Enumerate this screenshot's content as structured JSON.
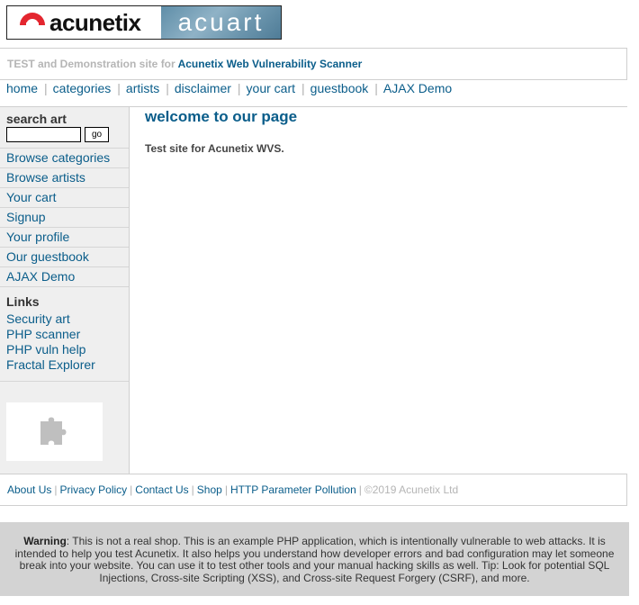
{
  "logo": {
    "brand_left": "acunetix",
    "brand_right": "acuart"
  },
  "tagline": {
    "prefix": "TEST and Demonstration site for",
    "product": "Acunetix Web Vulnerability Scanner"
  },
  "top_nav": {
    "items": [
      "home",
      "categories",
      "artists",
      "disclaimer",
      "your cart",
      "guestbook",
      "AJAX Demo"
    ]
  },
  "sidebar": {
    "search_title": "search art",
    "search_value": "",
    "go_label": "go",
    "menu": [
      "Browse categories",
      "Browse artists",
      "Your cart",
      "Signup",
      "Your profile",
      "Our guestbook",
      "AJAX Demo"
    ],
    "links_title": "Links",
    "links": [
      "Security art",
      "PHP scanner",
      "PHP vuln help",
      "Fractal Explorer"
    ]
  },
  "main": {
    "title": "welcome to our page",
    "intro": "Test site for Acunetix WVS."
  },
  "footer": {
    "links": [
      "About Us",
      "Privacy Policy",
      "Contact Us",
      "Shop",
      "HTTP Parameter Pollution"
    ],
    "copyright": "©2019 Acunetix Ltd"
  },
  "warning": {
    "label": "Warning",
    "text": ": This is not a real shop. This is an example PHP application, which is intentionally vulnerable to web attacks. It is intended to help you test Acunetix. It also helps you understand how developer errors and bad configuration may let someone break into your website. You can use it to test other tools and your manual hacking skills as well. Tip: Look for potential SQL Injections, Cross-site Scripting (XSS), and Cross-site Request Forgery (CSRF), and more."
  },
  "colors": {
    "link": "#0a5d8a",
    "muted": "#b5b5b5",
    "sidebar_bg": "#efefef",
    "warning_bg": "#d3d3d3",
    "logo_red": "#e3262f"
  },
  "icons": {
    "logo_mark": "acunetix-logo-icon",
    "sponsor": "puzzle-piece-icon"
  }
}
